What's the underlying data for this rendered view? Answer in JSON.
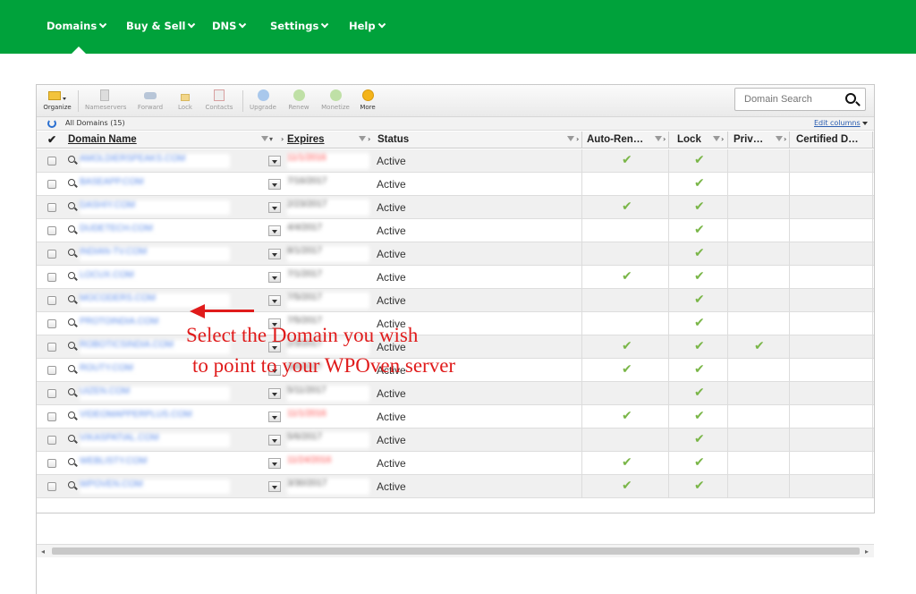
{
  "nav": {
    "items": [
      {
        "label": "Domains"
      },
      {
        "label": "Buy & Sell"
      },
      {
        "label": "DNS"
      },
      {
        "label": "Settings"
      },
      {
        "label": "Help"
      }
    ]
  },
  "toolbar": {
    "buttons": [
      {
        "label": "Organize",
        "icon": "folder-icon",
        "enabled": true
      },
      {
        "label": "Nameservers",
        "icon": "server-icon",
        "enabled": false
      },
      {
        "label": "Forward",
        "icon": "forward-icon",
        "enabled": false
      },
      {
        "label": "Lock",
        "icon": "lock-icon",
        "enabled": false
      },
      {
        "label": "Contacts",
        "icon": "contacts-icon",
        "enabled": false
      },
      {
        "label": "Upgrade",
        "icon": "upgrade-icon",
        "enabled": false
      },
      {
        "label": "Renew",
        "icon": "renew-icon",
        "enabled": false
      },
      {
        "label": "Monetize",
        "icon": "monetize-icon",
        "enabled": false
      },
      {
        "label": "More",
        "icon": "more-icon",
        "enabled": true
      }
    ],
    "search_placeholder": "Domain Search"
  },
  "subbar": {
    "all_domains": "All Domains (15)",
    "edit_columns": "Edit columns"
  },
  "table": {
    "columns": {
      "domain": "Domain Name",
      "expires": "Expires",
      "status": "Status",
      "autorenew": "Auto-Ren…",
      "lock": "Lock",
      "privacy": "Priv…",
      "certified": "Certified D…"
    },
    "rows": [
      {
        "domain": "AMOLDIERSPEAKS.COM",
        "expires": "11/1/2016",
        "expires_red": true,
        "status": "Active",
        "autorenew": true,
        "lock": true,
        "privacy": false
      },
      {
        "domain": "BASEAPP.COM",
        "expires": "7/16/2017",
        "expires_red": false,
        "status": "Active",
        "autorenew": false,
        "lock": true,
        "privacy": false
      },
      {
        "domain": "DASHIY.COM",
        "expires": "2/23/2017",
        "expires_red": false,
        "status": "Active",
        "autorenew": true,
        "lock": true,
        "privacy": false
      },
      {
        "domain": "DUDETECH.COM",
        "expires": "4/4/2017",
        "expires_red": false,
        "status": "Active",
        "autorenew": false,
        "lock": true,
        "privacy": false
      },
      {
        "domain": "INDIAN-TV.COM",
        "expires": "8/1/2017",
        "expires_red": false,
        "status": "Active",
        "autorenew": false,
        "lock": true,
        "privacy": false
      },
      {
        "domain": "LOCUX.COM",
        "expires": "7/1/2017",
        "expires_red": false,
        "status": "Active",
        "autorenew": true,
        "lock": true,
        "privacy": false
      },
      {
        "domain": "MOCODERS.COM",
        "expires": "7/5/2017",
        "expires_red": false,
        "status": "Active",
        "autorenew": false,
        "lock": true,
        "privacy": false
      },
      {
        "domain": "PROTOINDIA.COM",
        "expires": "7/5/2017",
        "expires_red": false,
        "status": "Active",
        "autorenew": false,
        "lock": true,
        "privacy": false
      },
      {
        "domain": "ROBOTICSINDIA.COM",
        "expires": "2/3/2017",
        "expires_red": false,
        "status": "Active",
        "autorenew": true,
        "lock": true,
        "privacy": true
      },
      {
        "domain": "ROUTY.COM",
        "expires": "9/8/2017",
        "expires_red": false,
        "status": "Active",
        "autorenew": true,
        "lock": true,
        "privacy": false
      },
      {
        "domain": "UIZEN.COM",
        "expires": "5/11/2017",
        "expires_red": false,
        "status": "Active",
        "autorenew": false,
        "lock": true,
        "privacy": false
      },
      {
        "domain": "VIDEOMAPPERPLUS.COM",
        "expires": "11/1/2016",
        "expires_red": true,
        "status": "Active",
        "autorenew": true,
        "lock": true,
        "privacy": false
      },
      {
        "domain": "VIKASPATIAL.COM",
        "expires": "5/6/2017",
        "expires_red": false,
        "status": "Active",
        "autorenew": false,
        "lock": true,
        "privacy": false
      },
      {
        "domain": "WEBLISTY.COM",
        "expires": "11/24/2016",
        "expires_red": true,
        "status": "Active",
        "autorenew": true,
        "lock": true,
        "privacy": false
      },
      {
        "domain": "WPOVEN.COM",
        "expires": "3/30/2017",
        "expires_red": false,
        "status": "Active",
        "autorenew": true,
        "lock": true,
        "privacy": false
      }
    ]
  },
  "annotation": {
    "line1": "Select the Domain you wish",
    "line2": "to point to your WPOven server"
  },
  "colors": {
    "brand_green": "#00a23b",
    "check_green": "#7ab648",
    "annotation_red": "#e01b1b"
  }
}
